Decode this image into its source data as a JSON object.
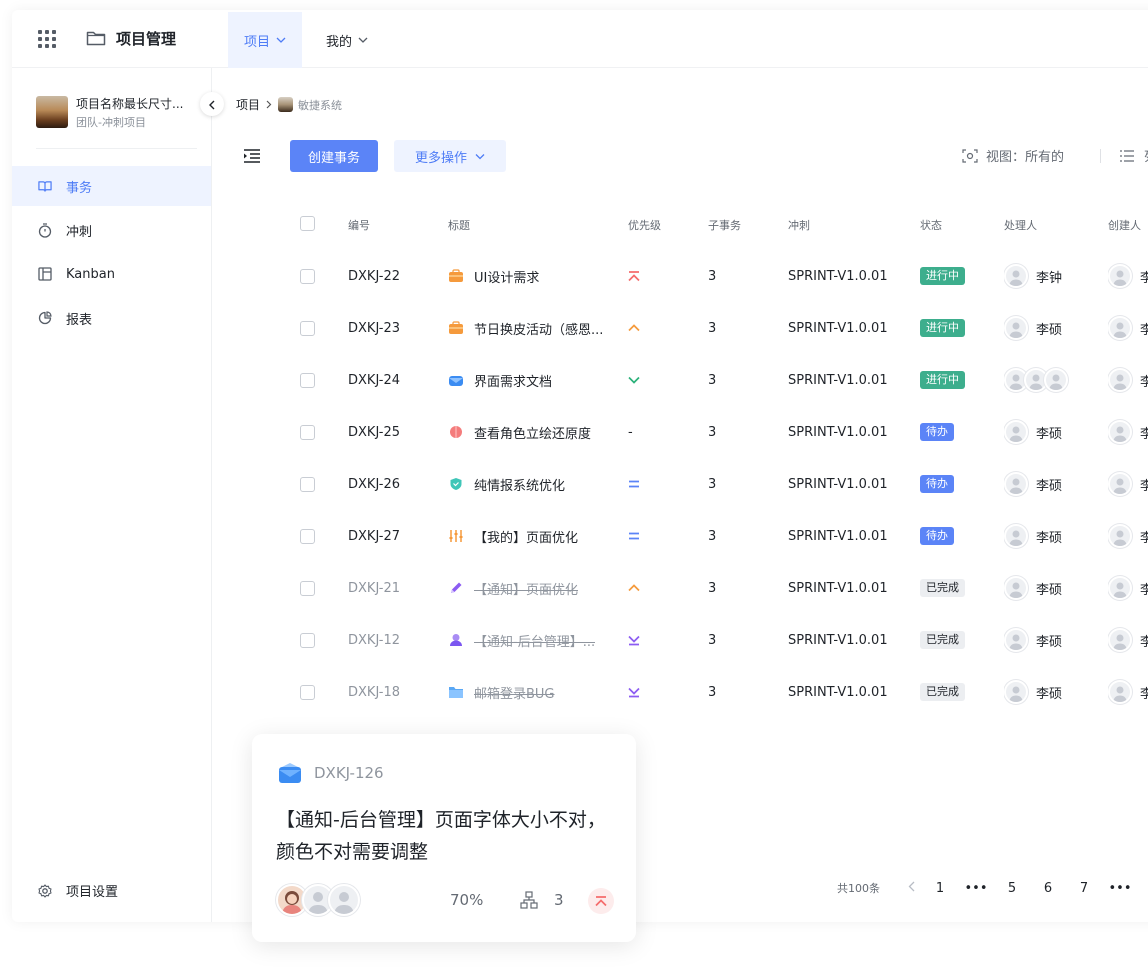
{
  "header": {
    "app_title": "项目管理",
    "tabs": [
      {
        "label": "项目",
        "active": true
      },
      {
        "label": "我的",
        "active": false
      }
    ]
  },
  "sidebar": {
    "project_name": "项目名称最长尺寸...",
    "project_sub": "团队-冲刺项目",
    "items": [
      {
        "label": "事务",
        "icon": "book-icon",
        "active": true
      },
      {
        "label": "冲刺",
        "icon": "stopwatch-icon",
        "active": false
      },
      {
        "label": "Kanban",
        "icon": "kanban-icon",
        "active": false
      },
      {
        "label": "报表",
        "icon": "pie-chart-icon",
        "active": false
      }
    ],
    "settings_label": "项目设置"
  },
  "breadcrumb": {
    "root": "项目",
    "current": "敏捷系统"
  },
  "toolbar": {
    "create_label": "创建事务",
    "more_label": "更多操作",
    "view_label": "视图：所有的",
    "list_label": "列表"
  },
  "table": {
    "headers": {
      "id": "编号",
      "title": "标题",
      "priority": "优先级",
      "subtasks": "子事务",
      "sprint": "冲刺",
      "status": "状态",
      "owner": "处理人",
      "creator": "创建人"
    },
    "rows": [
      {
        "id": "DXKJ-22",
        "title": "UI设计需求",
        "icon": "briefcase-icon",
        "priority": "highest",
        "subtasks": "3",
        "sprint": "SPRINT-V1.0.01",
        "status": "进行中",
        "status_type": "prog",
        "owner": "李钟",
        "creator": "李",
        "done": false,
        "multi_owner": false
      },
      {
        "id": "DXKJ-23",
        "title": "节日换皮活动（感恩...",
        "icon": "briefcase-icon",
        "priority": "high",
        "subtasks": "3",
        "sprint": "SPRINT-V1.0.01",
        "status": "进行中",
        "status_type": "prog",
        "owner": "李硕",
        "creator": "李",
        "done": false,
        "multi_owner": false
      },
      {
        "id": "DXKJ-24",
        "title": "界面需求文档",
        "icon": "mail-icon",
        "priority": "low",
        "subtasks": "3",
        "sprint": "SPRINT-V1.0.01",
        "status": "进行中",
        "status_type": "prog",
        "owner": "",
        "creator": "李",
        "done": false,
        "multi_owner": true
      },
      {
        "id": "DXKJ-25",
        "title": "查看角色立绘还原度",
        "icon": "bug-icon",
        "priority": "none",
        "subtasks": "3",
        "sprint": "SPRINT-V1.0.01",
        "status": "待办",
        "status_type": "todo",
        "owner": "李硕",
        "creator": "李",
        "done": false,
        "multi_owner": false
      },
      {
        "id": "DXKJ-26",
        "title": "纯情报系统优化",
        "icon": "shield-icon",
        "priority": "medium",
        "subtasks": "3",
        "sprint": "SPRINT-V1.0.01",
        "status": "待办",
        "status_type": "todo",
        "owner": "李硕",
        "creator": "李",
        "done": false,
        "multi_owner": false
      },
      {
        "id": "DXKJ-27",
        "title": "【我的】页面优化",
        "icon": "sliders-icon",
        "priority": "medium",
        "subtasks": "3",
        "sprint": "SPRINT-V1.0.01",
        "status": "待办",
        "status_type": "todo",
        "owner": "李硕",
        "creator": "李",
        "done": false,
        "multi_owner": false
      },
      {
        "id": "DXKJ-21",
        "title": "【通知】页面优化",
        "icon": "pen-icon",
        "priority": "high",
        "subtasks": "3",
        "sprint": "SPRINT-V1.0.01",
        "status": "已完成",
        "status_type": "done",
        "owner": "李硕",
        "creator": "李",
        "done": true,
        "multi_owner": false
      },
      {
        "id": "DXKJ-12",
        "title": "【通知-后台管理】...",
        "icon": "flask-icon",
        "priority": "lowest",
        "subtasks": "3",
        "sprint": "SPRINT-V1.0.01",
        "status": "已完成",
        "status_type": "done",
        "owner": "李硕",
        "creator": "李",
        "done": true,
        "multi_owner": false
      },
      {
        "id": "DXKJ-18",
        "title": "邮箱登录BUG",
        "icon": "folder-icon",
        "priority": "lowest",
        "subtasks": "3",
        "sprint": "SPRINT-V1.0.01",
        "status": "已完成",
        "status_type": "done",
        "owner": "李硕",
        "creator": "李",
        "done": true,
        "multi_owner": false
      }
    ]
  },
  "pagination": {
    "total": "共100条",
    "pages": [
      "1",
      "•••",
      "5",
      "6",
      "7",
      "•••"
    ]
  },
  "card": {
    "id": "DXKJ-126",
    "title": "【通知-后台管理】页面字体大小不对，颜色不对需要调整",
    "progress": "70%",
    "subtasks": "3"
  },
  "colors": {
    "accent": "#5b84f7",
    "accent_light": "#eef3ff",
    "status_progress": "#3dae8d",
    "priority_high": "#f56c6c",
    "priority_medium": "#f59a3c",
    "priority_low": "#2bb17a",
    "priority_lowest": "#8c5cf2"
  }
}
